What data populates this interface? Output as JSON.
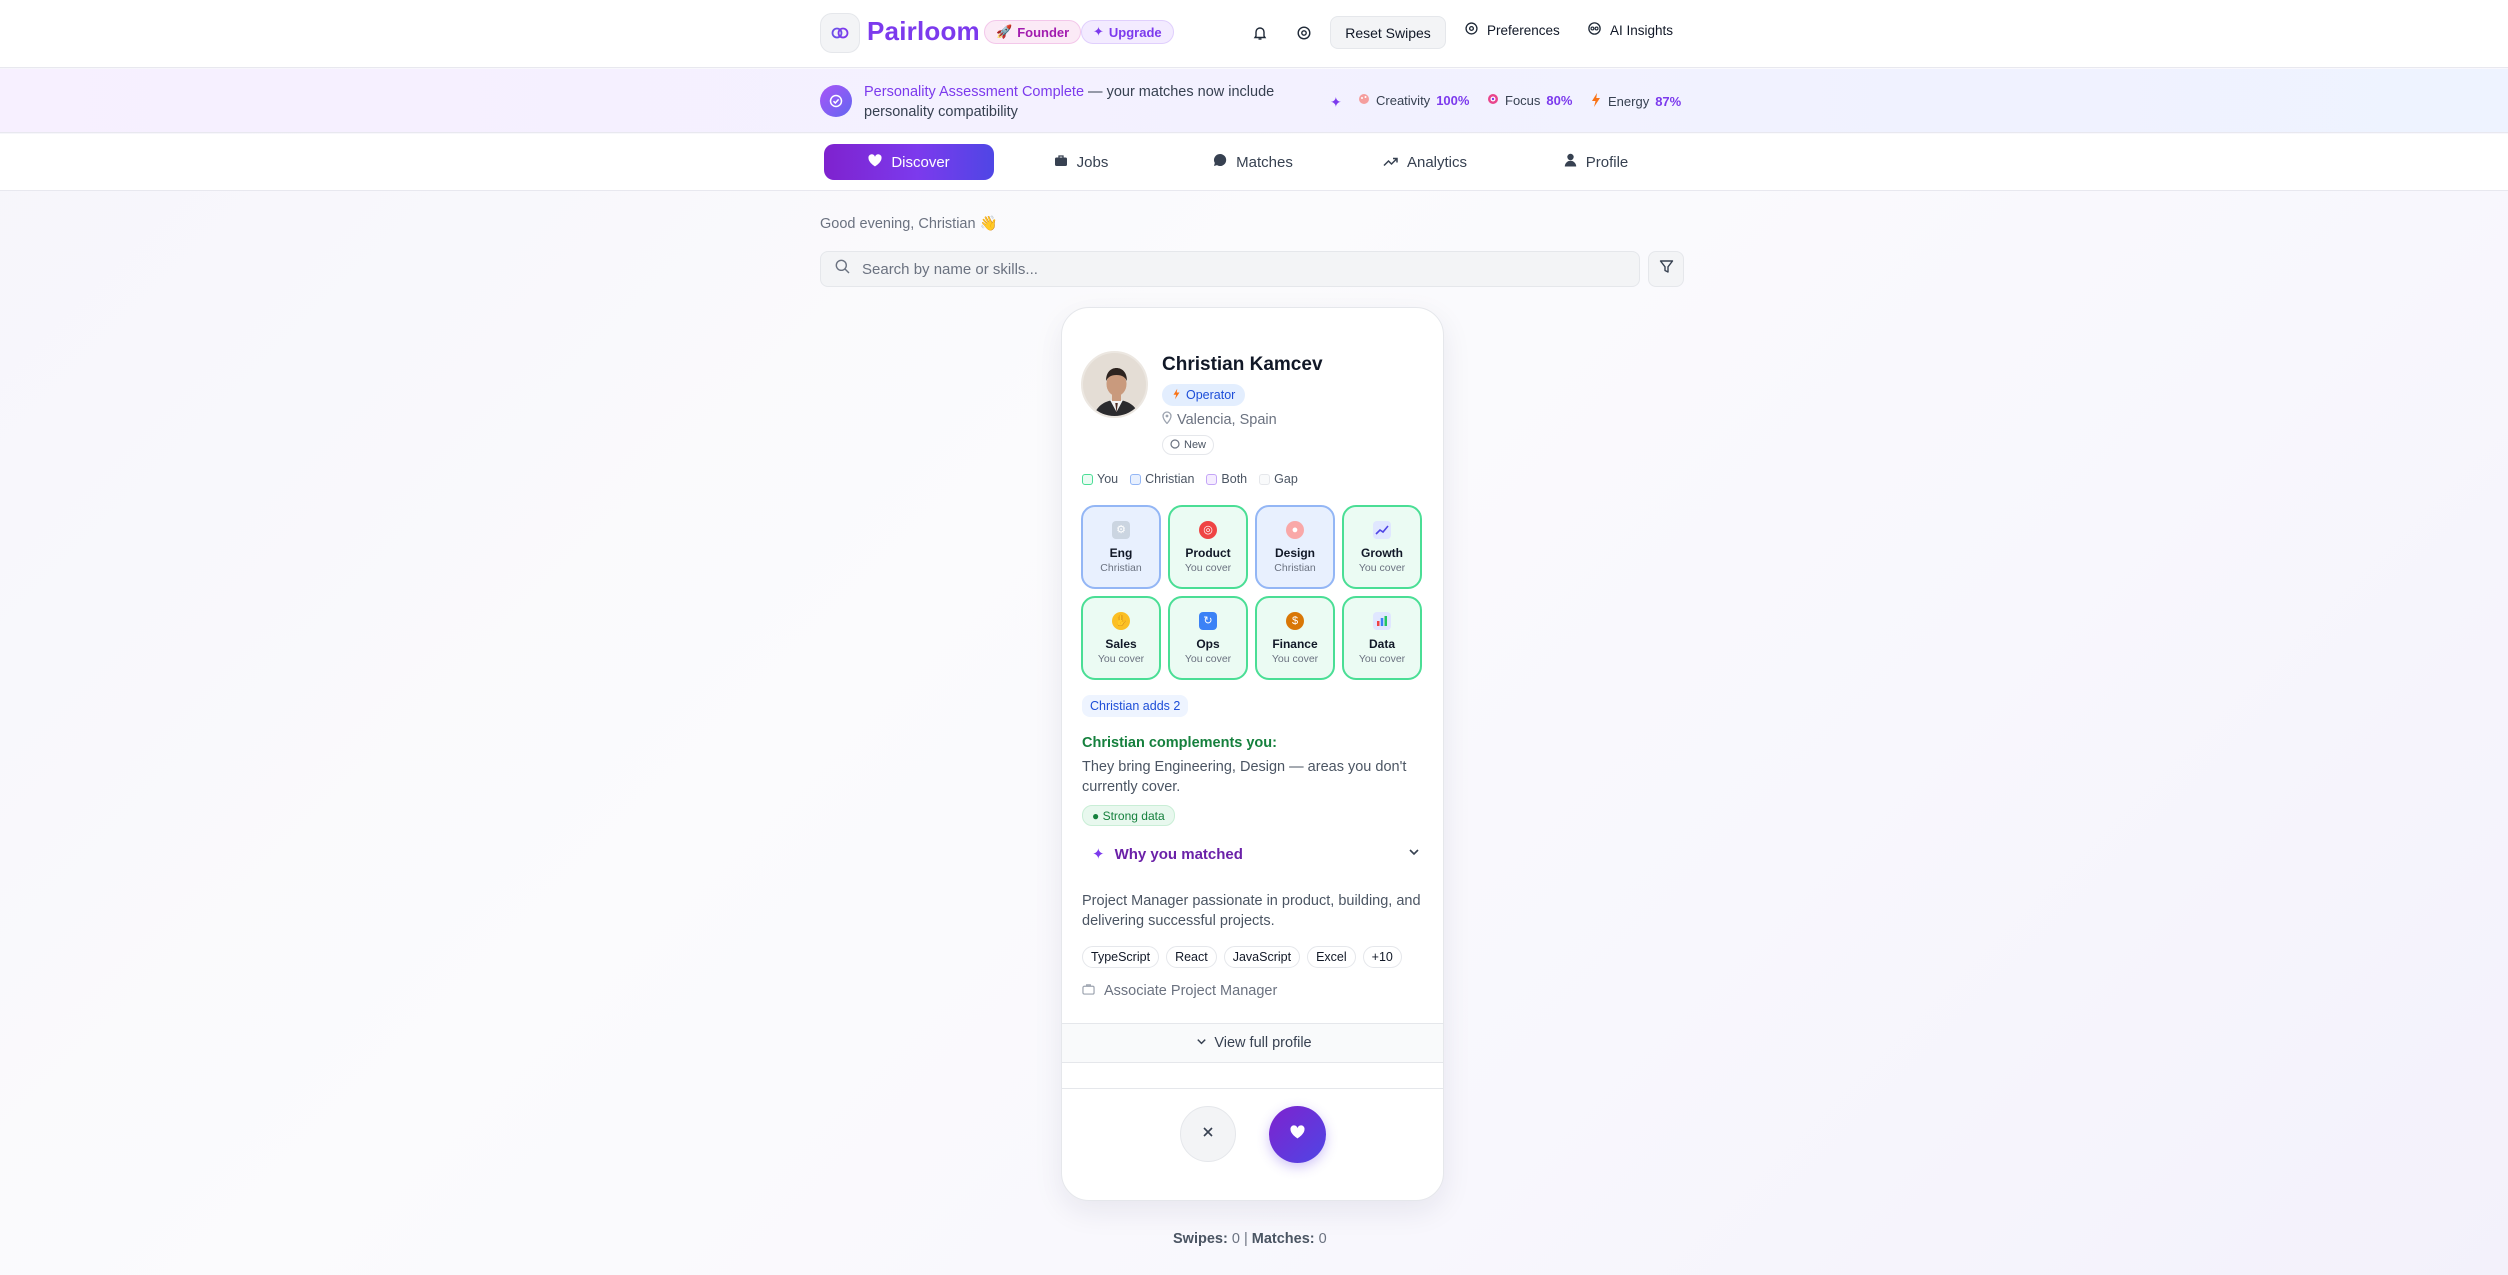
{
  "header": {
    "brand": "Pairloom",
    "founder_label": "Founder",
    "upgrade_label": "Upgrade",
    "reset_label": "Reset Swipes",
    "preferences_label": "Preferences",
    "insights_label": "AI Insights"
  },
  "banner": {
    "highlight": "Personality Assessment Complete",
    "text": " — your matches now include personality compatibility",
    "stats": [
      {
        "label": "Creativity",
        "value": "100%"
      },
      {
        "label": "Focus",
        "value": "80%"
      },
      {
        "label": "Energy",
        "value": "87%"
      }
    ]
  },
  "nav": {
    "tabs": [
      {
        "label": "Discover",
        "active": true
      },
      {
        "label": "Jobs"
      },
      {
        "label": "Matches"
      },
      {
        "label": "Analytics"
      },
      {
        "label": "Profile"
      }
    ]
  },
  "greeting": "Good evening, Christian 👋",
  "search": {
    "placeholder": "Search by name or skills..."
  },
  "card": {
    "name": "Christian Kamcev",
    "role": "Operator",
    "location": "Valencia, Spain",
    "status": "New",
    "legend": [
      "You",
      "Christian",
      "Both",
      "Gap"
    ],
    "tiles": [
      {
        "name": "Eng",
        "sub": "Christian",
        "owner": "them",
        "icon": "gear-icon"
      },
      {
        "name": "Product",
        "sub": "You cover",
        "owner": "you",
        "icon": "target-icon"
      },
      {
        "name": "Design",
        "sub": "Christian",
        "owner": "them",
        "icon": "palette-icon"
      },
      {
        "name": "Growth",
        "sub": "You cover",
        "owner": "you",
        "icon": "chart-up-icon"
      },
      {
        "name": "Sales",
        "sub": "You cover",
        "owner": "you",
        "icon": "handshake-icon"
      },
      {
        "name": "Ops",
        "sub": "You cover",
        "owner": "you",
        "icon": "refresh-icon"
      },
      {
        "name": "Finance",
        "sub": "You cover",
        "owner": "you",
        "icon": "money-bag-icon"
      },
      {
        "name": "Data",
        "sub": "You cover",
        "owner": "you",
        "icon": "bar-chart-icon"
      }
    ],
    "adds": "Christian adds 2",
    "complement_title": "Christian complements you:",
    "complement_text": "They bring Engineering, Design — areas you don't currently cover.",
    "data_strength": "● Strong data",
    "why_label": "Why you matched",
    "bio": "Project Manager passionate in product, building, and delivering successful projects.",
    "skills": [
      "TypeScript",
      "React",
      "JavaScript",
      "Excel",
      "+10"
    ],
    "job_title": "Associate Project Manager",
    "view_full": "View full profile"
  },
  "footer": {
    "swipes_label": "Swipes:",
    "swipes": "0",
    "matches_label": "Matches:",
    "matches": "0"
  },
  "colors": {
    "accent": "#7c3aed",
    "you": "#4ade95",
    "them": "#93b6f5"
  }
}
